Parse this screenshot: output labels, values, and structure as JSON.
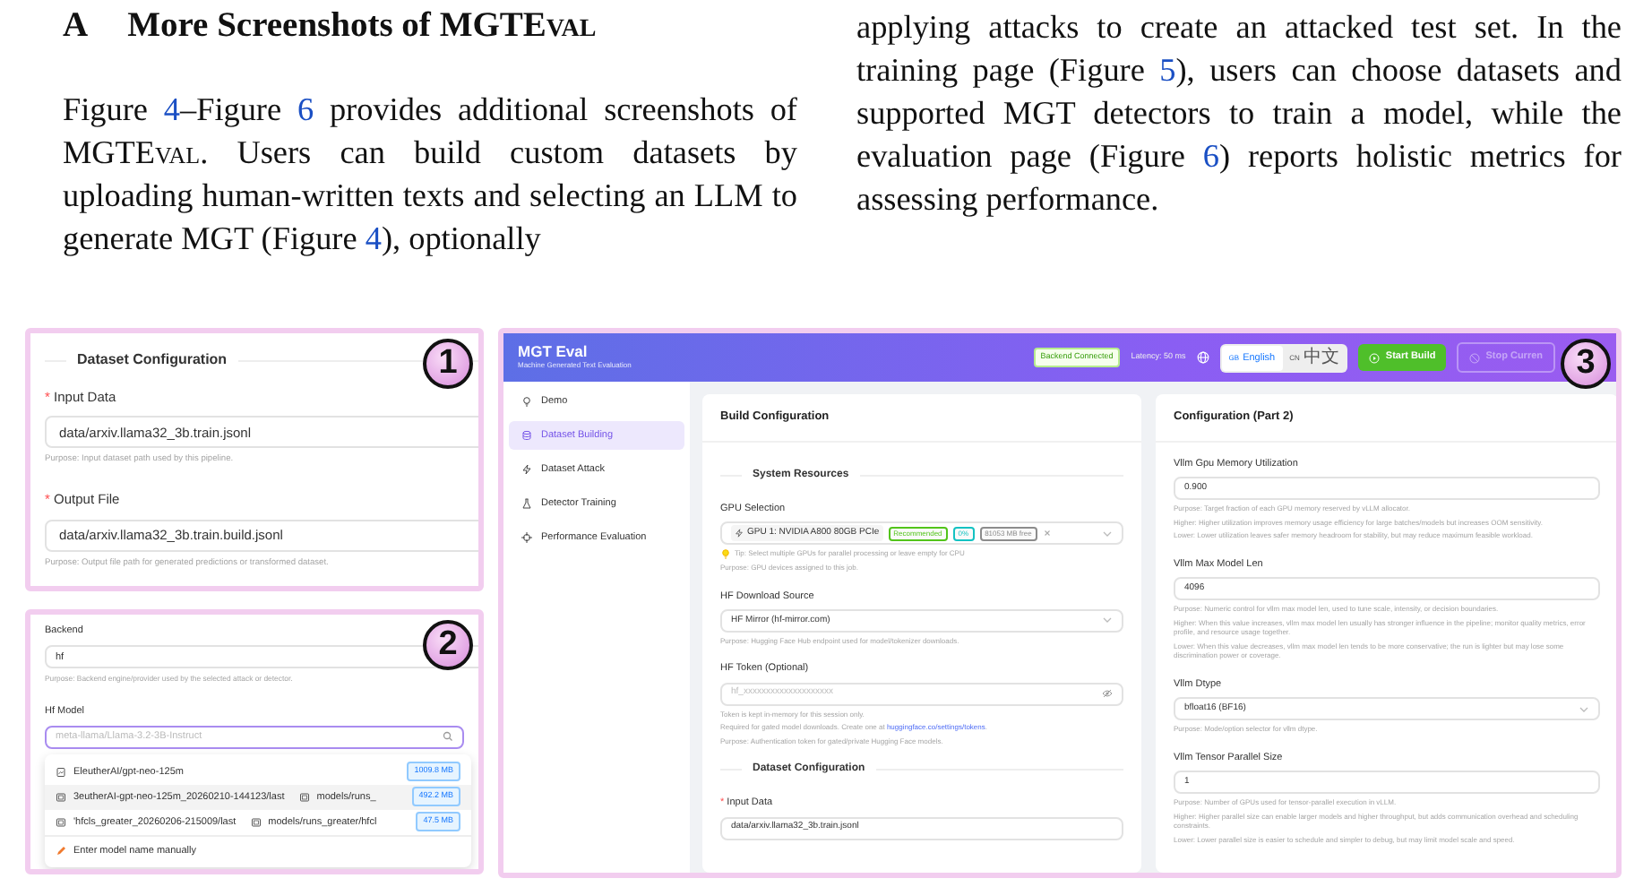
{
  "section_heading": {
    "number": "A",
    "title": [
      {
        "kind": "text",
        "text": "More Screenshots of "
      },
      {
        "kind": "smallcaps",
        "text": "MGTEval"
      }
    ]
  },
  "columns": [
    {
      "segments": [
        {
          "kind": "text",
          "text": "Figure "
        },
        {
          "kind": "ref",
          "text": "4"
        },
        {
          "kind": "text",
          "text": "–Figure "
        },
        {
          "kind": "ref",
          "text": "6"
        },
        {
          "kind": "text",
          "text": " provides additional screenshots of "
        },
        {
          "kind": "smallcaps",
          "text": "MGTEval"
        },
        {
          "kind": "text",
          "text": ". Users can build custom datasets by uploading human-written texts and selecting an LLM to generate MGT (Figure "
        },
        {
          "kind": "ref",
          "text": "4"
        },
        {
          "kind": "text",
          "text": "), optionally"
        }
      ]
    },
    {
      "segments": [
        {
          "kind": "text",
          "text": "applying attacks to create an attacked test set. In the training page (Figure "
        },
        {
          "kind": "ref",
          "text": "5"
        },
        {
          "kind": "text",
          "text": "), users can choose datasets and supported MGT detectors to train a model, while the evaluation page (Figure "
        },
        {
          "kind": "ref",
          "text": "6"
        },
        {
          "kind": "text",
          "text": ") reports holistic metrics for assessing performance."
        }
      ]
    }
  ],
  "figure": {
    "panel_1": {
      "callout": "1",
      "items": [
        {
          "kind": "section",
          "text": "Dataset Configuration"
        },
        {
          "kind": "field",
          "label": "Input Data",
          "marker": "*",
          "control": {
            "kind": "input",
            "value": "data/arxiv.llama32_3b.train.jsonl"
          },
          "help": [
            {
              "kind": "note",
              "text": "Purpose: Input dataset path used by this pipeline."
            }
          ]
        },
        {
          "kind": "field",
          "label": "Output File",
          "marker": "*",
          "control": {
            "kind": "input",
            "value": "data/arxiv.llama32_3b.train.build.jsonl"
          },
          "help": [
            {
              "kind": "note",
              "text": "Purpose: Output file path for generated predictions or transformed dataset."
            }
          ]
        }
      ]
    },
    "panel_2": {
      "callout": "2",
      "items": [
        {
          "kind": "field",
          "label": "Backend",
          "control": {
            "kind": "input",
            "value": "hf"
          },
          "help": [
            {
              "kind": "note",
              "text": "Purpose: Backend engine/provider used by the selected attack or detector."
            }
          ]
        }
      ],
      "hf_model": {
        "label": "Hf Model",
        "placeholder": "meta-llama/Llama-3.2-3B-Instruct",
        "options": [
          {
            "name": "EleutherAI/gpt-neo-125m",
            "size": "1009.8 MB",
            "selected": false
          },
          {
            "name": "3eutherAI-gpt-neo-125m_20260210-144123/last",
            "path": "models/runs_",
            "size": "492.2 MB",
            "selected": true
          },
          {
            "name": "'hfcls_greater_20260206-215009/last",
            "path": "models/runs_greater/hfcl",
            "size": "47.5 MB",
            "selected": false
          }
        ],
        "manual_entry": "Enter model name manually"
      }
    },
    "app": {
      "callout": "3",
      "title": "MGT Eval",
      "subtitle": "Machine Generated Text Evaluation",
      "status": "Backend Connected",
      "latency": "Latency: 50 ms",
      "languages": [
        {
          "code": "GB",
          "label": "English",
          "selected": true
        },
        {
          "code": "CN",
          "label": "中文",
          "selected": false
        }
      ],
      "start_button": "Start Build",
      "stop_button": {
        "label": "Stop Curren",
        "disabled": true
      },
      "nav": [
        {
          "label": "Demo",
          "selected": false
        },
        {
          "label": "Dataset Building",
          "selected": true
        },
        {
          "label": "Dataset Attack",
          "selected": false
        },
        {
          "label": "Detector Training",
          "selected": false
        },
        {
          "label": "Performance Evaluation",
          "selected": false
        }
      ],
      "cards": [
        {
          "title": "Build Configuration",
          "items": [
            {
              "kind": "section",
              "text": "System Resources"
            },
            {
              "kind": "field",
              "label": "GPU Selection",
              "control": {
                "kind": "gpu",
                "chip": "GPU 1: NVIDIA A800 80GB PCIe",
                "tags": [
                  {
                    "text": "Recommended",
                    "color": "#52c41a"
                  },
                  {
                    "text": "0%",
                    "color": "#13c2c2"
                  },
                  {
                    "text": "81053 MB free",
                    "color": "#8c8c8c"
                  }
                ]
              },
              "help": [
                {
                  "kind": "tip",
                  "text": "Tip: Select multiple GPUs for parallel processing or leave empty for CPU"
                },
                {
                  "kind": "note",
                  "text": "Purpose: GPU devices assigned to this job."
                }
              ]
            },
            {
              "kind": "field",
              "label": "HF Download Source",
              "control": {
                "kind": "select",
                "value": "HF Mirror (hf-mirror.com)"
              },
              "help": [
                {
                  "kind": "note",
                  "text": "Purpose: Hugging Face Hub endpoint used for model/tokenizer downloads."
                }
              ]
            },
            {
              "kind": "field",
              "label": "HF Token (Optional)",
              "control": {
                "kind": "password",
                "placeholder": "hf_xxxxxxxxxxxxxxxxxxxx"
              },
              "help": [
                {
                  "kind": "note",
                  "text": "Token is kept in-memory for this session only."
                },
                {
                  "kind": "link",
                  "text": "Required for gated model downloads. Create one at ",
                  "link": "huggingface.co/settings/tokens",
                  "after": "."
                },
                {
                  "kind": "note",
                  "text": "Purpose: Authentication token for gated/private Hugging Face models."
                }
              ]
            },
            {
              "kind": "section",
              "text": "Dataset Configuration"
            },
            {
              "kind": "field",
              "label": "Input Data",
              "marker": "*",
              "control": {
                "kind": "input",
                "value": "data/arxiv.llama32_3b.train.jsonl"
              }
            }
          ]
        },
        {
          "title": "Configuration (Part 2)",
          "items": [
            {
              "kind": "field",
              "label": "Vllm Gpu Memory Utilization",
              "control": {
                "kind": "input",
                "value": "0.900"
              },
              "help": [
                {
                  "kind": "note",
                  "text": "Purpose: Target fraction of each GPU memory reserved by vLLM allocator."
                },
                {
                  "kind": "note",
                  "text": "Higher: Higher utilization improves memory usage efficiency for large batches/models but increases OOM sensitivity."
                },
                {
                  "kind": "note",
                  "text": "Lower: Lower utilization leaves safer memory headroom for stability, but may reduce maximum feasible workload."
                }
              ]
            },
            {
              "kind": "field",
              "label": "Vllm Max Model Len",
              "control": {
                "kind": "input",
                "value": "4096"
              },
              "help": [
                {
                  "kind": "note",
                  "text": "Purpose: Numeric control for vllm max model len, used to tune scale, intensity, or decision boundaries."
                },
                {
                  "kind": "note",
                  "text": "Higher: When this value increases, vllm max model len usually has stronger influence in the pipeline; monitor quality metrics, error profile, and resource usage together."
                },
                {
                  "kind": "note",
                  "text": "Lower: When this value decreases, vllm max model len tends to be more conservative; the run is lighter but may lose some discrimination power or coverage."
                }
              ]
            },
            {
              "kind": "field",
              "label": "Vllm Dtype",
              "control": {
                "kind": "select",
                "value": "bfloat16 (BF16)"
              },
              "help": [
                {
                  "kind": "note",
                  "text": "Purpose: Mode/option selector for vllm dtype."
                }
              ]
            },
            {
              "kind": "field",
              "label": "Vllm Tensor Parallel Size",
              "control": {
                "kind": "input",
                "value": "1"
              },
              "help": [
                {
                  "kind": "note",
                  "text": "Purpose: Number of GPUs used for tensor-parallel execution in vLLM."
                },
                {
                  "kind": "note",
                  "text": "Higher: Higher parallel size can enable larger models and higher throughput, but adds communication overhead and scheduling constraints."
                },
                {
                  "kind": "note",
                  "text": "Lower: Lower parallel size is easier to schedule and simpler to debug, but may limit model scale and speed."
                }
              ]
            }
          ]
        }
      ]
    }
  }
}
